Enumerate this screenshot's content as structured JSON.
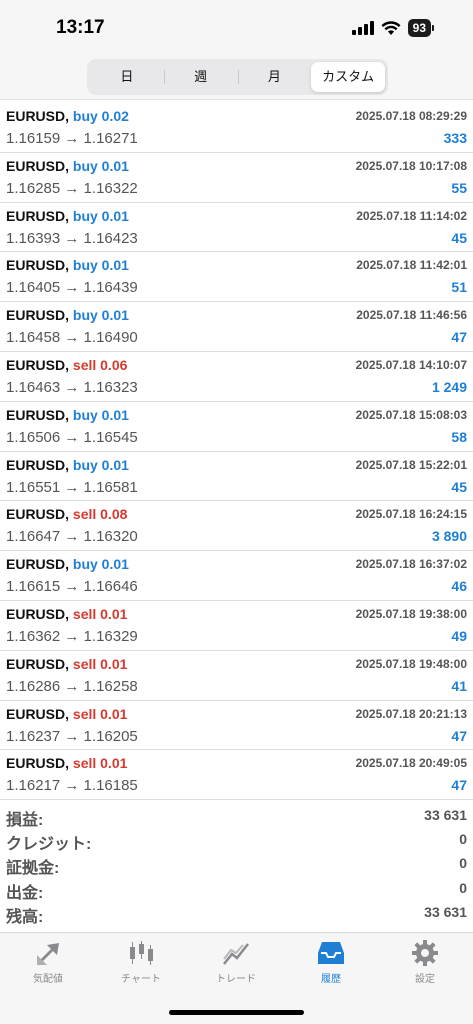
{
  "status": {
    "time": "13:17",
    "battery": "93"
  },
  "segments": [
    "日",
    "週",
    "月",
    "カスタム"
  ],
  "trades": [
    {
      "symbol": "EURUSD,",
      "side": "buy 0.02",
      "dir": "buy",
      "datetime": "2025.07.18 08:29:29",
      "prices": "1.16159 → 1.16271",
      "profit": "333"
    },
    {
      "symbol": "EURUSD,",
      "side": "buy 0.01",
      "dir": "buy",
      "datetime": "2025.07.18 10:17:08",
      "prices": "1.16285 → 1.16322",
      "profit": "55"
    },
    {
      "symbol": "EURUSD,",
      "side": "buy 0.01",
      "dir": "buy",
      "datetime": "2025.07.18 11:14:02",
      "prices": "1.16393 → 1.16423",
      "profit": "45"
    },
    {
      "symbol": "EURUSD,",
      "side": "buy 0.01",
      "dir": "buy",
      "datetime": "2025.07.18 11:42:01",
      "prices": "1.16405 → 1.16439",
      "profit": "51"
    },
    {
      "symbol": "EURUSD,",
      "side": "buy 0.01",
      "dir": "buy",
      "datetime": "2025.07.18 11:46:56",
      "prices": "1.16458 → 1.16490",
      "profit": "47"
    },
    {
      "symbol": "EURUSD,",
      "side": "sell 0.06",
      "dir": "sell",
      "datetime": "2025.07.18 14:10:07",
      "prices": "1.16463 → 1.16323",
      "profit": "1 249"
    },
    {
      "symbol": "EURUSD,",
      "side": "buy 0.01",
      "dir": "buy",
      "datetime": "2025.07.18 15:08:03",
      "prices": "1.16506 → 1.16545",
      "profit": "58"
    },
    {
      "symbol": "EURUSD,",
      "side": "buy 0.01",
      "dir": "buy",
      "datetime": "2025.07.18 15:22:01",
      "prices": "1.16551 → 1.16581",
      "profit": "45"
    },
    {
      "symbol": "EURUSD,",
      "side": "sell 0.08",
      "dir": "sell",
      "datetime": "2025.07.18 16:24:15",
      "prices": "1.16647 → 1.16320",
      "profit": "3 890"
    },
    {
      "symbol": "EURUSD,",
      "side": "buy 0.01",
      "dir": "buy",
      "datetime": "2025.07.18 16:37:02",
      "prices": "1.16615 → 1.16646",
      "profit": "46"
    },
    {
      "symbol": "EURUSD,",
      "side": "sell 0.01",
      "dir": "sell",
      "datetime": "2025.07.18 19:38:00",
      "prices": "1.16362 → 1.16329",
      "profit": "49"
    },
    {
      "symbol": "EURUSD,",
      "side": "sell 0.01",
      "dir": "sell",
      "datetime": "2025.07.18 19:48:00",
      "prices": "1.16286 → 1.16258",
      "profit": "41"
    },
    {
      "symbol": "EURUSD,",
      "side": "sell 0.01",
      "dir": "sell",
      "datetime": "2025.07.18 20:21:13",
      "prices": "1.16237 → 1.16205",
      "profit": "47"
    },
    {
      "symbol": "EURUSD,",
      "side": "sell 0.01",
      "dir": "sell",
      "datetime": "2025.07.18 20:49:05",
      "prices": "1.16217 → 1.16185",
      "profit": "47"
    }
  ],
  "summary": [
    {
      "label": "損益:",
      "value": "33 631"
    },
    {
      "label": "クレジット:",
      "value": "0"
    },
    {
      "label": "証拠金:",
      "value": "0"
    },
    {
      "label": "出金:",
      "value": "0"
    },
    {
      "label": "残高:",
      "value": "33 631"
    }
  ],
  "tabs": [
    {
      "label": "気配値",
      "icon": "quotes-arrows-icon"
    },
    {
      "label": "チャート",
      "icon": "candlestick-chart-icon"
    },
    {
      "label": "トレード",
      "icon": "trade-line-icon"
    },
    {
      "label": "履歴",
      "icon": "history-inbox-icon",
      "active": true
    },
    {
      "label": "設定",
      "icon": "gear-icon"
    }
  ],
  "colors": {
    "buy": "#1f7fd4",
    "sell": "#d63a2f",
    "accent": "#1f7fd4",
    "inactive": "#8a8a8e"
  }
}
